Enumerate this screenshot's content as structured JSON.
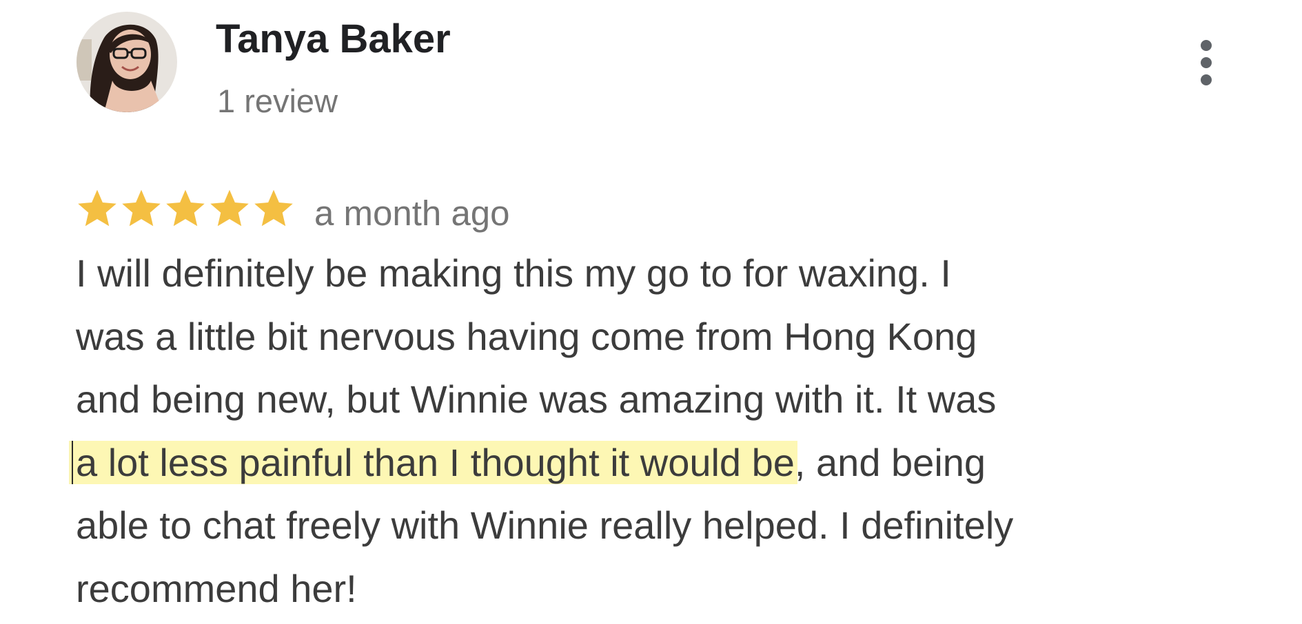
{
  "review": {
    "reviewer_name": "Tanya Baker",
    "review_count": "1 review",
    "rating": 5,
    "star_color": "#f4bf42",
    "date": "a month ago",
    "text_lines": [
      {
        "before": "I will definitely be making this my go to for waxing. I",
        "highlight": "",
        "after": ""
      },
      {
        "before": "was a little bit nervous having come from Hong Kong",
        "highlight": "",
        "after": ""
      },
      {
        "before": "and being new, but Winnie was amazing with it. It was",
        "highlight": "",
        "after": ""
      },
      {
        "before": "",
        "highlight": "a lot less painful than I thought it would be",
        "after": ", and being"
      },
      {
        "before": "able to chat freely with Winnie really helped. I definitely",
        "highlight": "",
        "after": ""
      },
      {
        "before": "recommend her!",
        "highlight": "",
        "after": ""
      }
    ],
    "highlight_color": "#fdf7b4"
  },
  "icons": {
    "avatar": "profile-photo",
    "more": "more-vert-icon",
    "star": "star-icon"
  }
}
